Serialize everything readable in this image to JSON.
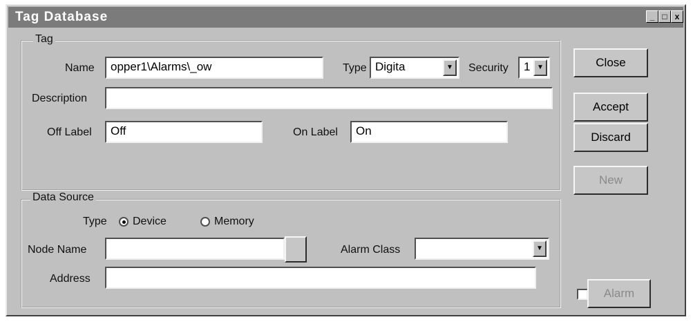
{
  "window": {
    "title": "Tag Database",
    "controls": [
      "_",
      "□",
      "x"
    ]
  },
  "tag_group": {
    "legend": "Tag",
    "name_label": "Name",
    "name_value": "opper1\\Alarms\\_ow",
    "type_label": "Type",
    "type_value": "Digita",
    "security_label": "Security",
    "security_value": "1",
    "description_label": "Description",
    "description_value": "",
    "off_label_label": "Off Label",
    "off_label_value": "Off",
    "on_label_label": "On Label",
    "on_label_value": "On"
  },
  "data_source_group": {
    "legend": "Data Source",
    "type_label": "Type",
    "radio_device_label": "Device",
    "radio_memory_label": "Memory",
    "selected": "Device",
    "node_name_label": "Node Name",
    "node_name_value": "",
    "alarm_class_label": "Alarm Class",
    "alarm_class_value": "",
    "address_label": "Address",
    "address_value": ""
  },
  "buttons": {
    "close": "Close",
    "accept": "Accept",
    "discard": "Discard",
    "new": "New",
    "alarm": "Alarm"
  }
}
